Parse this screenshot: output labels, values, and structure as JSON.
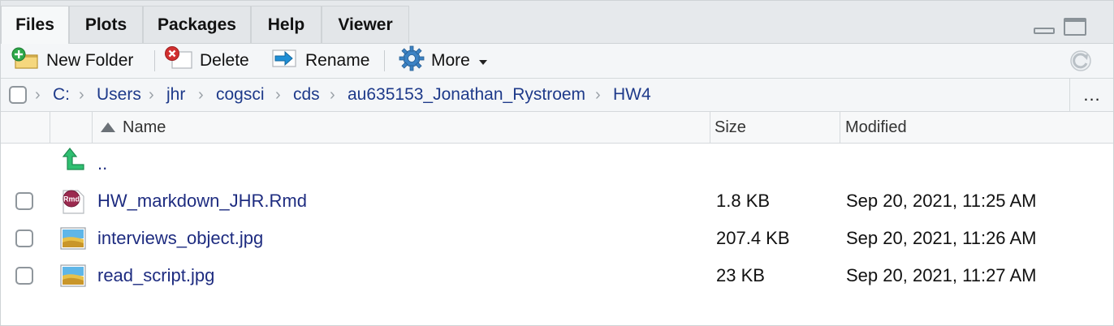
{
  "tabs": [
    {
      "label": "Files",
      "active": true
    },
    {
      "label": "Plots",
      "active": false
    },
    {
      "label": "Packages",
      "active": false
    },
    {
      "label": "Help",
      "active": false
    },
    {
      "label": "Viewer",
      "active": false
    }
  ],
  "toolbar": {
    "new_folder": "New Folder",
    "delete": "Delete",
    "rename": "Rename",
    "more": "More"
  },
  "breadcrumb": [
    "C:",
    "Users",
    "jhr",
    "cogsci",
    "cds",
    "au635153_Jonathan_Rystroem",
    "HW4"
  ],
  "breadcrumb_more": "...",
  "columns": {
    "name": "Name",
    "size": "Size",
    "modified": "Modified"
  },
  "parent_row": {
    "label": ".."
  },
  "files": [
    {
      "name": "HW_markdown_JHR.Rmd",
      "size": "1.8 KB",
      "modified": "Sep 20, 2021, 11:25 AM",
      "icon": "rmd-file-icon"
    },
    {
      "name": "interviews_object.jpg",
      "size": "207.4 KB",
      "modified": "Sep 20, 2021, 11:26 AM",
      "icon": "image-file-icon"
    },
    {
      "name": "read_script.jpg",
      "size": "23 KB",
      "modified": "Sep 20, 2021, 11:27 AM",
      "icon": "image-file-icon"
    }
  ],
  "colors": {
    "link": "#1e3a8a",
    "file_link": "#1e2c80",
    "pane_bg": "#f4f6f8"
  }
}
